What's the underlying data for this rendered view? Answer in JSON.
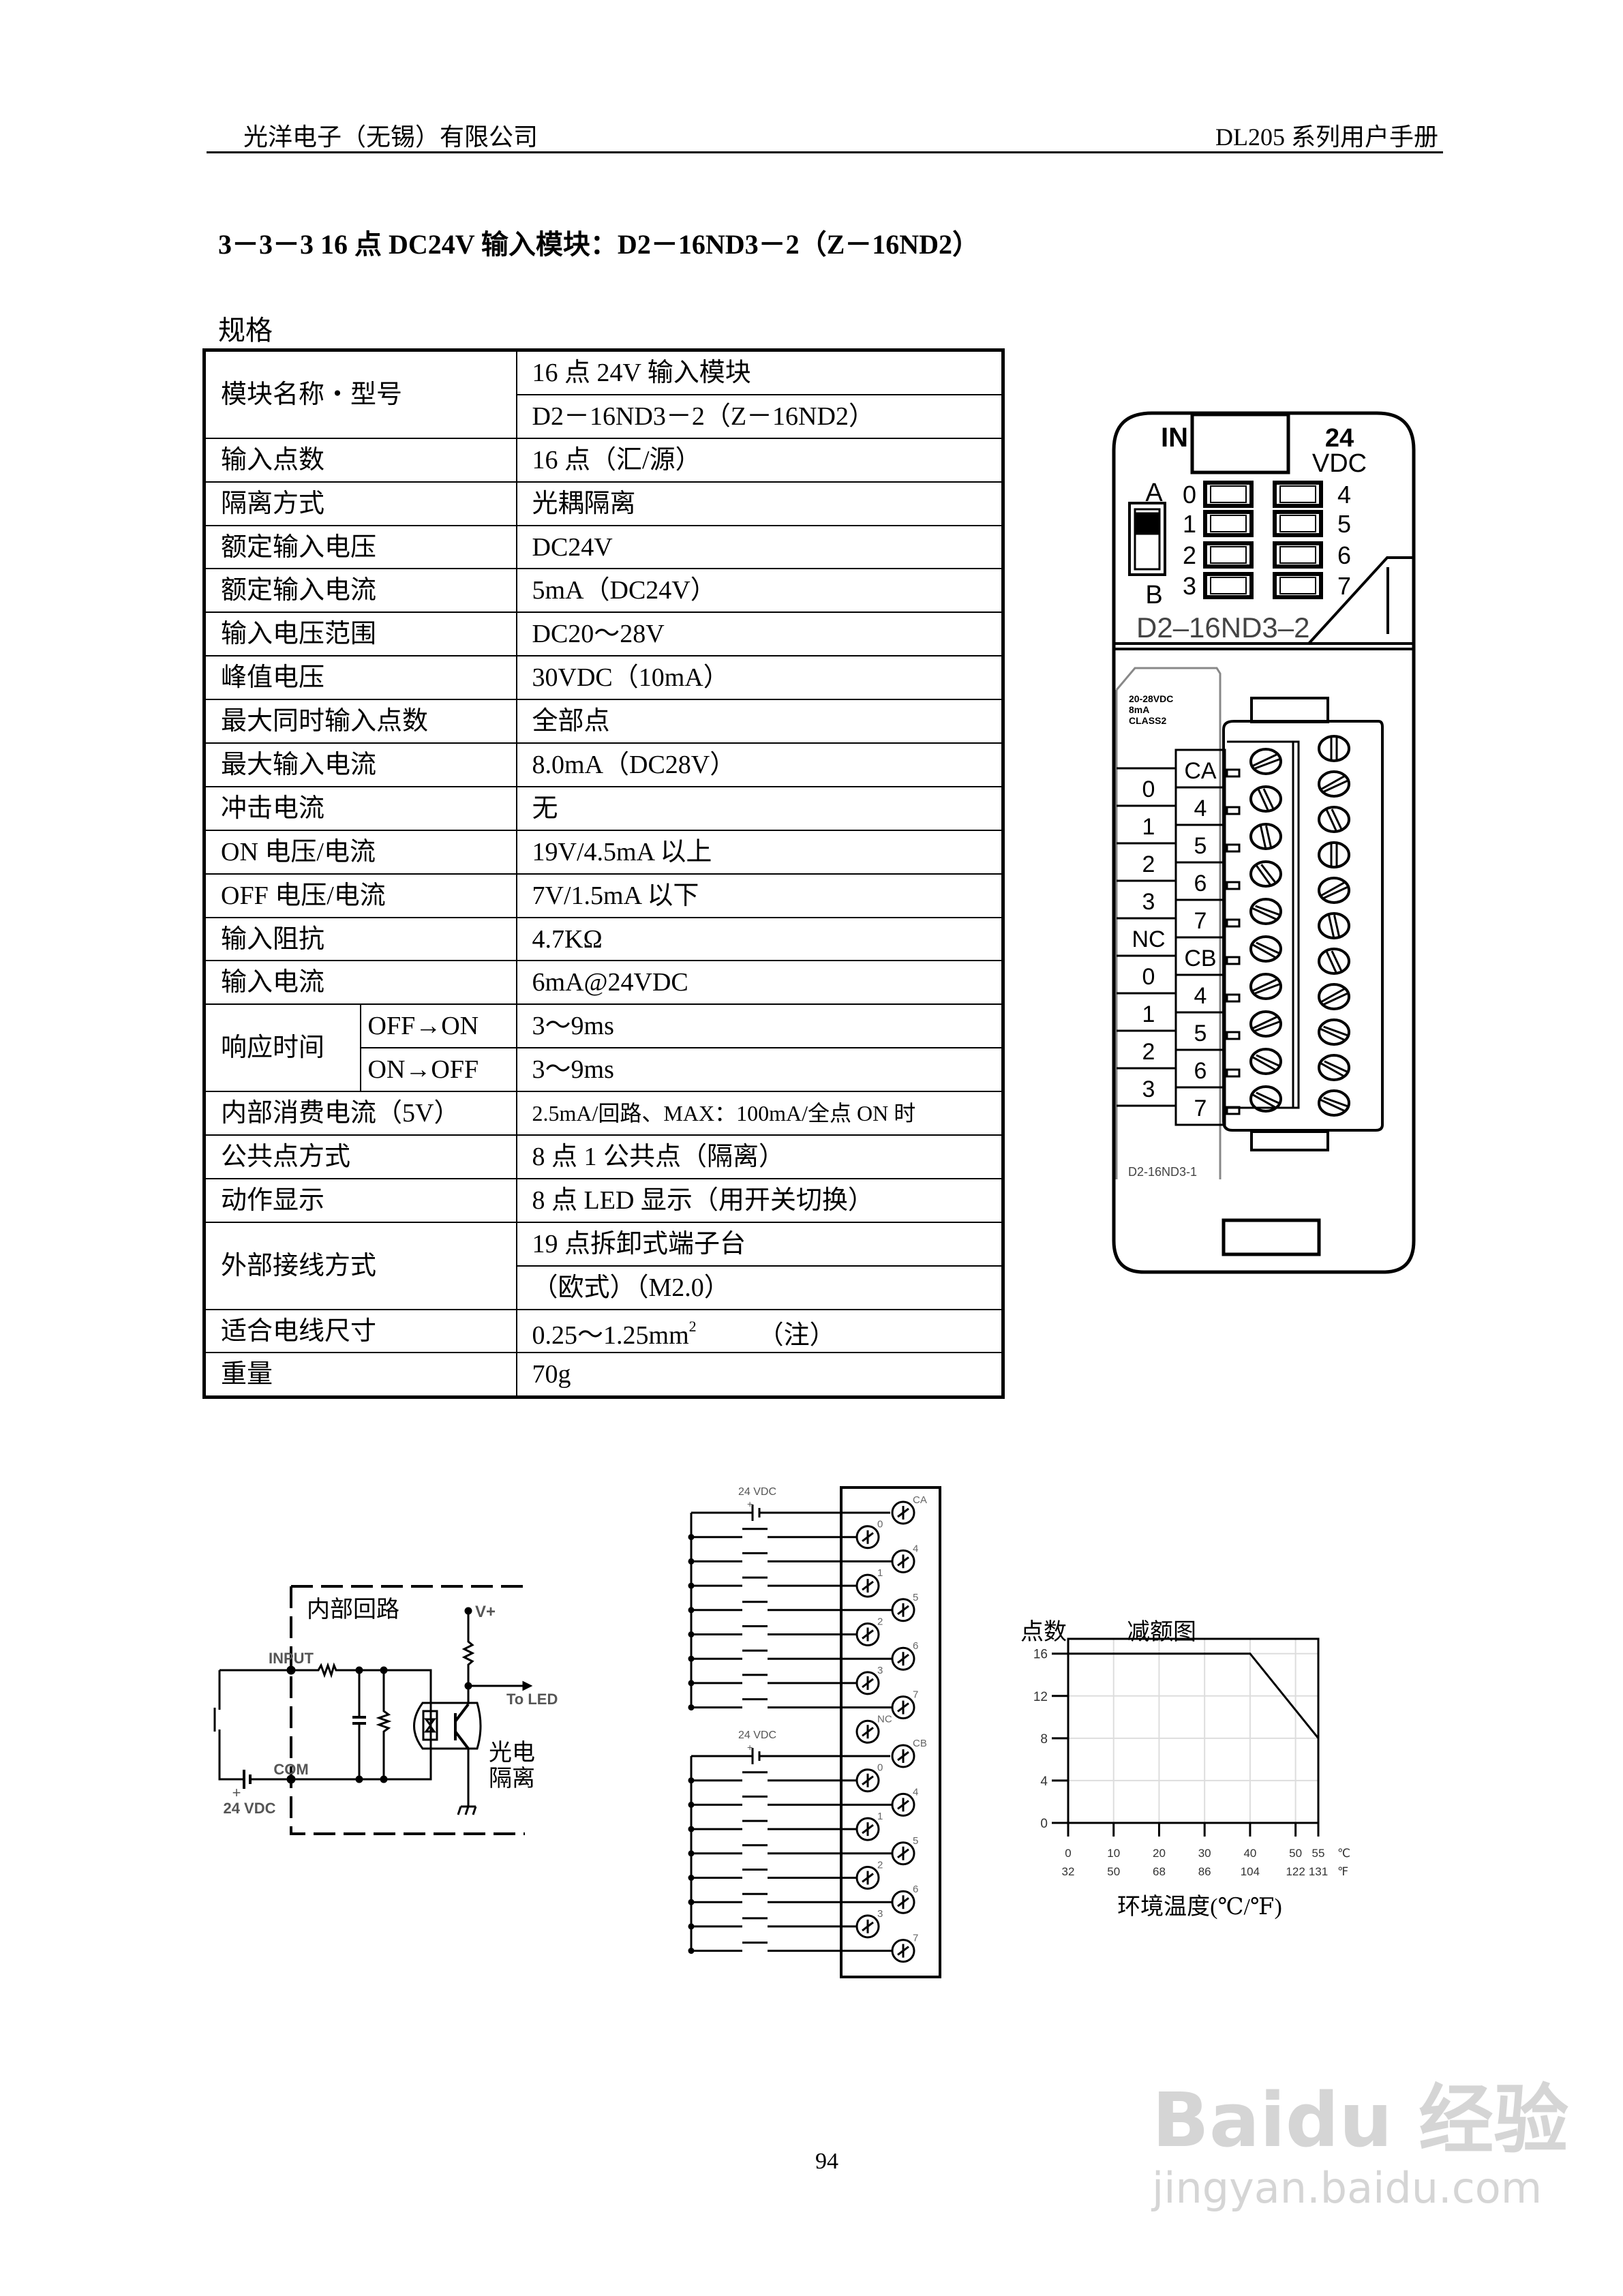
{
  "header": {
    "company": "光洋电子（无锡）有限公司",
    "manual": "DL205 系列用户手册"
  },
  "section_title": "3－3－3  16 点 DC24V 输入模块：D2－16ND3－2（Z－16ND2）",
  "spec_label": "规格",
  "spec_table": {
    "model_label": "模块名称・型号",
    "model_name": "16 点 24V 输入模块",
    "model_number": "D2－16ND3－2（Z－16ND2）",
    "rows": [
      {
        "label": "输入点数",
        "value": "16 点（汇/源）"
      },
      {
        "label": "隔离方式",
        "value": "光耦隔离"
      },
      {
        "label": "额定输入电压",
        "value": "DC24V"
      },
      {
        "label": "额定输入电流",
        "value": "5mA（DC24V）"
      },
      {
        "label": "输入电压范围",
        "value": "DC20～28V"
      },
      {
        "label": "峰值电压",
        "value": "30VDC（10mA）"
      },
      {
        "label": "最大同时输入点数",
        "value": "全部点"
      },
      {
        "label": "最大输入电流",
        "value": "8.0mA（DC28V）"
      },
      {
        "label": "冲击电流",
        "value": "无"
      },
      {
        "label": "ON 电压/电流",
        "value": "19V/4.5mA 以上"
      },
      {
        "label": "OFF 电压/电流",
        "value": "7V/1.5mA 以下"
      },
      {
        "label": "输入阻抗",
        "value": "4.7KΩ"
      },
      {
        "label": "输入电流",
        "value": "6mA@24VDC"
      }
    ],
    "response": {
      "label": "响应时间",
      "off_on_label": "OFF→ON",
      "off_on_value": "3～9ms",
      "on_off_label": "ON→OFF",
      "on_off_value": "3～9ms"
    },
    "rows2": [
      {
        "label": "内部消费电流（5V）",
        "value": "2.5mA/回路、MAX：100mA/全点 ON 时"
      },
      {
        "label": "公共点方式",
        "value": "8 点 1 公共点（隔离）"
      },
      {
        "label": "动作显示",
        "value": "8 点 LED 显示（用开关切换）"
      }
    ],
    "wiring": {
      "label": "外部接线方式",
      "value_line1": "19 点拆卸式端子台",
      "value_line2": "（欧式）（M2.0）"
    },
    "wire_size": {
      "label": "适合电线尺寸",
      "value": "0.25～1.25mm",
      "sup": "2",
      "note": "（注）"
    },
    "weight": {
      "label": "重量",
      "value": "70g"
    }
  },
  "module": {
    "in_label": "IN",
    "voltage_line1": "24",
    "voltage_line2": "VDC",
    "switch_a": "A",
    "switch_b": "B",
    "led_left": [
      "0",
      "1",
      "2",
      "3"
    ],
    "led_right": [
      "4",
      "5",
      "6",
      "7"
    ],
    "model": "D2–16ND3–2",
    "rating": [
      "20-28VDC",
      "8mA",
      "CLASS2"
    ],
    "terminal_left": [
      "0",
      "1",
      "2",
      "3",
      "NC",
      "0",
      "1",
      "2",
      "3"
    ],
    "terminal_right": [
      "CA",
      "4",
      "5",
      "6",
      "7",
      "CB",
      "4",
      "5",
      "6",
      "7"
    ],
    "block_label": "D2-16ND3-1"
  },
  "circuit": {
    "title": "内部回路",
    "input": "INPUT",
    "com": "COM",
    "plus": "+",
    "supply": "24 VDC",
    "vplus": "V+",
    "to_led": "To LED",
    "opto_line1": "光电",
    "opto_line2": "隔离"
  },
  "wiring_diagram": {
    "supply": "24 VDC",
    "plus": "+",
    "terminals": [
      "CA",
      "0",
      "4",
      "1",
      "5",
      "2",
      "6",
      "3",
      "7",
      "NC",
      "CB",
      "0",
      "4",
      "1",
      "5",
      "2",
      "6",
      "3",
      "7"
    ]
  },
  "chart_data": {
    "type": "line",
    "title": "减额图",
    "ylabel": "点数",
    "xlabel": "环境温度(℃/℉)",
    "x_ticks_c": [
      "0",
      "10",
      "20",
      "30",
      "40",
      "50",
      "55"
    ],
    "x_ticks_f": [
      "32",
      "50",
      "68",
      "86",
      "104",
      "122",
      "131"
    ],
    "x_unit_c": "℃",
    "x_unit_f": "℉",
    "y_ticks": [
      "0",
      "4",
      "8",
      "12",
      "16"
    ],
    "x": [
      0,
      40,
      55
    ],
    "y": [
      16,
      16,
      8
    ],
    "xlim": [
      0,
      55
    ],
    "ylim": [
      0,
      17.4
    ],
    "grid": true
  },
  "page_number": "94",
  "watermark": {
    "brand": "Baidu 经验",
    "url": "jingyan.baidu.com"
  }
}
